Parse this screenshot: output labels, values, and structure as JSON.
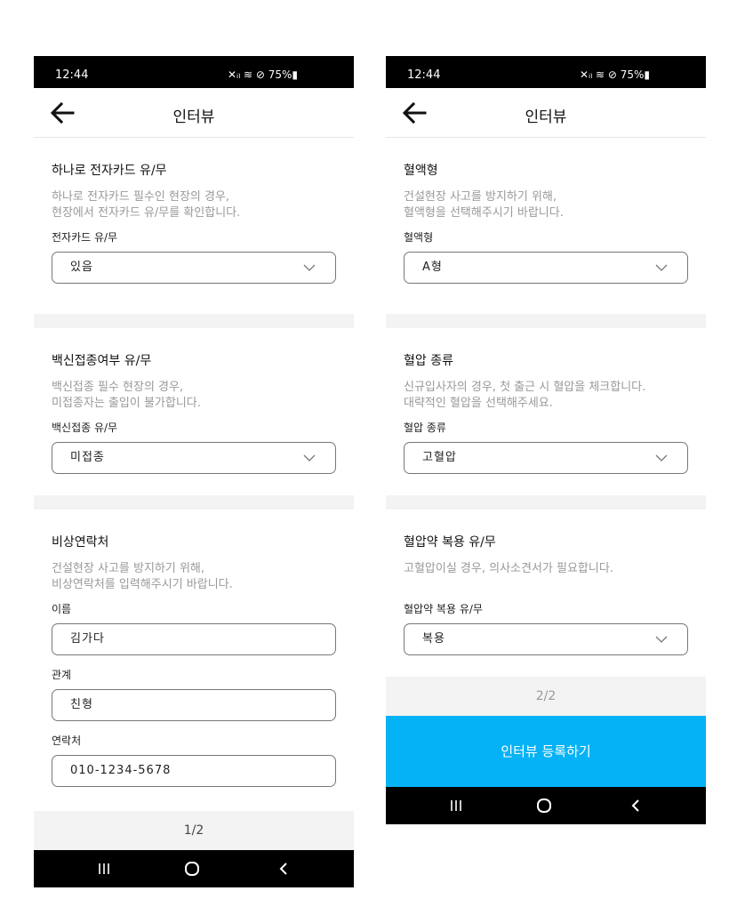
{
  "status_bar": {
    "time": "12:44",
    "icons": "✕ᵢₗ ≋ ⊘ 75%▮",
    "battery": "75%"
  },
  "app_bar": {
    "title": "인터뷰"
  },
  "icons": {
    "back": "arrow-left-icon",
    "dropdown": "chevron-down-icon",
    "recent": "recent-apps-icon",
    "home": "home-icon",
    "nav_back": "nav-back-icon"
  },
  "colors": {
    "accent": "#06b2f6",
    "status_bar": "#000000",
    "divider": "#f3f3f3",
    "muted_text": "#999999"
  },
  "page1": {
    "sections": [
      {
        "title": "하나로 전자카드 유/무",
        "desc1": "하나로 전자카드 필수인 현장의 경우,",
        "desc2": "현장에서 전자카드 유/무를 확인합니다.",
        "label": "전자카드 유/무",
        "value": "있음"
      },
      {
        "title": "백신접종여부 유/무",
        "desc1": "백신접종 필수 현장의 경우,",
        "desc2": "미접종자는 출입이 불가합니다.",
        "label": "백신접종 유/무",
        "value": "미접종"
      },
      {
        "title": "비상연락처",
        "desc1": "건설현장 사고를 방지하기 위해,",
        "desc2": "비상연락처를 입력해주시기 바랍니다.",
        "fields": [
          {
            "label": "이름",
            "value": "김가다"
          },
          {
            "label": "관계",
            "value": "친형"
          },
          {
            "label": "연락처",
            "value": "010-1234-5678"
          }
        ]
      }
    ],
    "pager": "1/2"
  },
  "page2": {
    "sections": [
      {
        "title": "혈액형",
        "desc1": "건설현장 사고를 방지하기 위해,",
        "desc2": "혈액형을 선택해주시기 바랍니다.",
        "label": "혈액형",
        "value": "A형"
      },
      {
        "title": "혈압 종류",
        "desc1": "신규입사자의 경우, 첫 출근 시 혈압을 체크합니다.",
        "desc2": "대략적인 혈압을 선택해주세요.",
        "label": "혈압 종류",
        "value": "고혈압"
      },
      {
        "title": "혈압약 복용 유/무",
        "desc1": "고혈압이실 경우, 의사소견서가 필요합니다.",
        "label": "혈압약 복용 유/무",
        "value": "복용"
      }
    ],
    "pager": "2/2",
    "submit_label": "인터뷰 등록하기"
  }
}
